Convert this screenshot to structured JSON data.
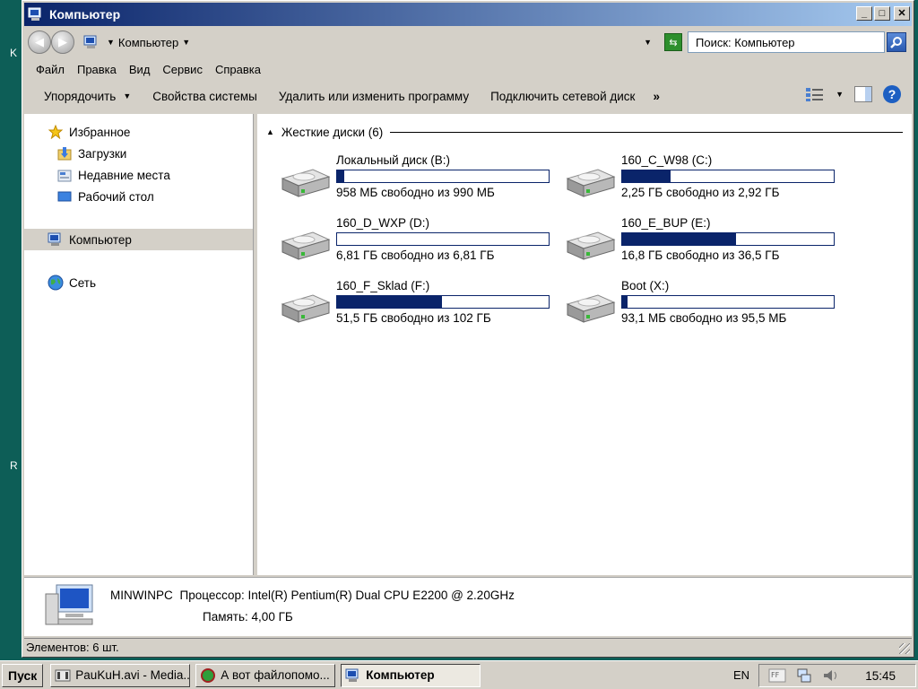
{
  "desktop": {
    "letter_top": "K",
    "letter_bottom": "R"
  },
  "window": {
    "title": "Компьютер",
    "buttons": {
      "minimize": "_",
      "maximize": "□",
      "close": "✕"
    }
  },
  "address": {
    "path": "Компьютер",
    "search_placeholder": "Поиск: Компьютер"
  },
  "menu": [
    "Файл",
    "Правка",
    "Вид",
    "Сервис",
    "Справка"
  ],
  "commands": {
    "organize": "Упорядочить",
    "system_properties": "Свойства системы",
    "uninstall": "Удалить или изменить программу",
    "map_drive": "Подключить сетевой диск",
    "more": "»"
  },
  "navigation": {
    "favorites": "Избранное",
    "downloads": "Загрузки",
    "recent": "Недавние места",
    "desktop": "Рабочий стол",
    "computer": "Компьютер",
    "network": "Сеть"
  },
  "group": {
    "title": "Жесткие диски (6)"
  },
  "drives": [
    {
      "name": "Локальный диск (B:)",
      "free_text": "958 МБ свободно из 990 МБ",
      "used_fraction": 0.032
    },
    {
      "name": "160_C_W98 (C:)",
      "free_text": "2,25 ГБ свободно из 2,92 ГБ",
      "used_fraction": 0.229
    },
    {
      "name": "160_D_WXP (D:)",
      "free_text": "6,81 ГБ свободно из 6,81 ГБ",
      "used_fraction": 0.0
    },
    {
      "name": "160_E_BUP (E:)",
      "free_text": "16,8 ГБ свободно из 36,5 ГБ",
      "used_fraction": 0.54
    },
    {
      "name": "160_F_Sklad (F:)",
      "free_text": "51,5 ГБ свободно из 102 ГБ",
      "used_fraction": 0.495
    },
    {
      "name": "Boot (X:)",
      "free_text": "93,1 МБ свободно из 95,5 МБ",
      "used_fraction": 0.025
    }
  ],
  "details": {
    "computer_name": "MINWINPC",
    "processor_label": "Процессор:",
    "processor_value": "Intel(R) Pentium(R) Dual  CPU  E2200  @ 2.20GHz",
    "memory_label": "Память:",
    "memory_value": "4,00 ГБ"
  },
  "status": {
    "items_text": "Элементов: 6 шт."
  },
  "taskbar": {
    "start": "Пуск",
    "tasks": [
      "PauKuH.avi - Media...",
      "А вот файлопомо...",
      "Компьютер"
    ],
    "language": "EN",
    "clock": "15:45"
  },
  "colors": {
    "desktop": "#0d5e57",
    "title_start": "#0a246a",
    "title_end": "#a6caf0",
    "bar_fill": "#0a246a"
  },
  "icons": [
    "computer-icon",
    "star-icon",
    "downloads-folder-icon",
    "recent-places-icon",
    "desktop-icon",
    "network-globe-icon",
    "hard-disk-icon",
    "search-icon",
    "refresh-icon",
    "help-icon"
  ]
}
